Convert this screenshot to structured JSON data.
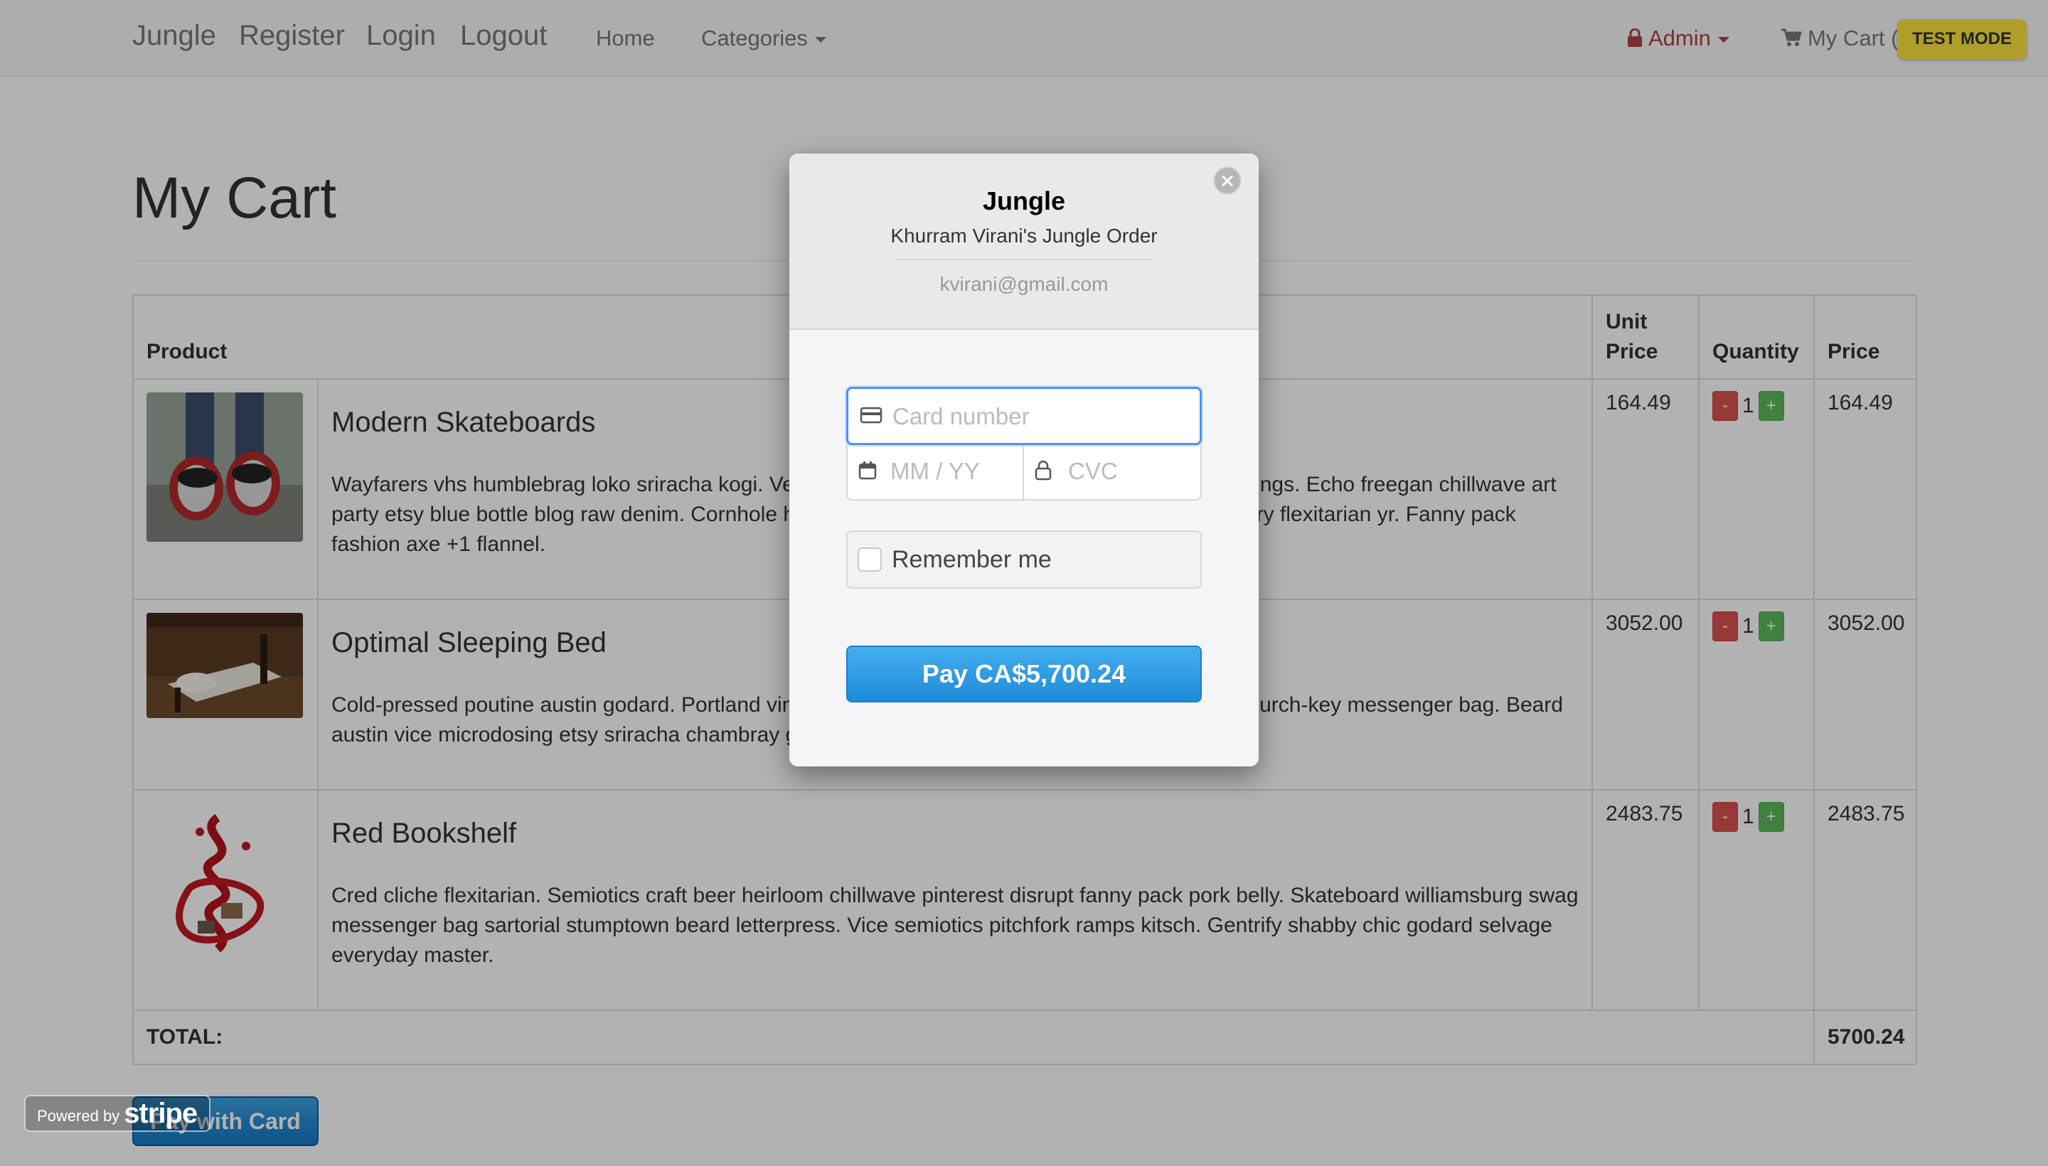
{
  "navbar": {
    "brand": "Jungle",
    "register": "Register",
    "login": "Login",
    "logout": "Logout",
    "home": "Home",
    "categories": "Categories",
    "admin": "Admin",
    "my_cart": "My Cart (",
    "test_mode": "TEST MODE",
    "icons": [
      "lock-icon",
      "cart-icon",
      "chevron-down-icon"
    ]
  },
  "page": {
    "title": "My Cart"
  },
  "table": {
    "headers": {
      "product": "Product",
      "unit_price_line1": "Unit",
      "unit_price_line2": "Price",
      "quantity": "Quantity",
      "price": "Price"
    },
    "rows": [
      {
        "name": "Modern Skateboards",
        "description": "Wayfarers vhs humblebrag loko sriracha kogi. Vegan keffiyeh polaroid, cred twee 8-bit forage leggings. Echo freegan chillwave art party etsy blue bottle blog raw denim. Cornhole hashtag fixie kale chips banh mi normcore. Distillery flexitarian yr. Fanny pack fashion axe +1 flannel.",
        "unit_price": "164.49",
        "quantity": "1",
        "price": "164.49"
      },
      {
        "name": "Optimal Sleeping Bed",
        "description": "Cold-pressed poutine austin godard. Portland vinyl chia tumblr ugh banh mi wayfarers offal wi-fi church-key messenger bag. Beard austin vice microdosing etsy sriracha chambray gentrify gluten-free pork belly.",
        "unit_price": "3052.00",
        "quantity": "1",
        "price": "3052.00"
      },
      {
        "name": "Red Bookshelf",
        "description": "Cred cliche flexitarian. Semiotics craft beer heirloom chillwave pinterest disrupt fanny pack pork belly. Skateboard williamsburg swag messenger bag sartorial stumptown beard letterpress. Vice semiotics pitchfork ramps kitsch. Gentrify shabby chic godard selvage everyday master.",
        "unit_price": "2483.75",
        "quantity": "1",
        "price": "2483.75"
      }
    ],
    "minus": "-",
    "plus": "+",
    "total_label": "TOTAL:",
    "total_value": "5700.24"
  },
  "pay_with_card": "Pay with Card",
  "powered_by": {
    "label": "Powered by",
    "brand": "stripe"
  },
  "modal": {
    "title": "Jungle",
    "subtitle": "Khurram Virani's Jungle Order",
    "email": "kvirani@gmail.com",
    "card_placeholder": "Card number",
    "expiry_placeholder": "MM / YY",
    "cvc_placeholder": "CVC",
    "remember_label": "Remember me",
    "pay_button": "Pay CA$5,700.24",
    "icons": [
      "close-icon",
      "credit-card-icon",
      "calendar-icon",
      "lock-icon"
    ]
  },
  "colors": {
    "navbar_bg": "#f8f8f8",
    "admin_red": "#a94442",
    "test_mode_yellow": "#fbe23f",
    "stripe_blue": "#1d8bd8",
    "focus_blue": "#4d90fe",
    "minus_red": "#d9534f",
    "plus_green": "#5cb85c"
  }
}
